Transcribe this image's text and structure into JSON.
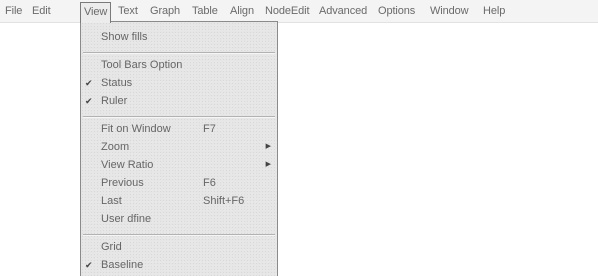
{
  "menubar": {
    "items": [
      {
        "label": "File"
      },
      {
        "label": "Edit"
      },
      {
        "label": "View"
      },
      {
        "label": "Text"
      },
      {
        "label": "Graph"
      },
      {
        "label": "Table"
      },
      {
        "label": "Align"
      },
      {
        "label": "NodeEdit"
      },
      {
        "label": "Advanced"
      },
      {
        "label": "Options"
      },
      {
        "label": "Window"
      },
      {
        "label": "Help"
      }
    ]
  },
  "view_menu": {
    "show_fills": "Show fills",
    "tool_bars_option": "Tool Bars Option",
    "status": "Status",
    "ruler": "Ruler",
    "fit_on_window": "Fit on Window",
    "fit_on_window_shortcut": "F7",
    "zoom": "Zoom",
    "view_ratio": "View Ratio",
    "previous": "Previous",
    "previous_shortcut": "F6",
    "last": "Last",
    "last_shortcut": "Shift+F6",
    "user_define": "User dfine",
    "grid": "Grid",
    "baseline": "Baseline",
    "check_glyph": "✔",
    "submenu_arrow": "▶"
  }
}
